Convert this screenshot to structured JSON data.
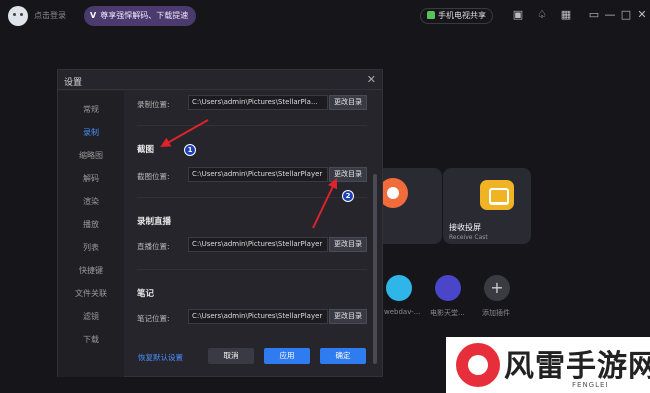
{
  "topbar": {
    "login": "点击登录",
    "vip": "尊享强悍解码、下载提速",
    "vip_mark": "V",
    "share": "手机电视共享",
    "icons": [
      "box-icon",
      "bell-icon",
      "grid-icon",
      "mini-icon",
      "minimize-icon",
      "maximize-icon",
      "close-icon"
    ]
  },
  "main": {
    "cast_title": "接收投屏",
    "cast_sub": "Receive Cast",
    "tools": [
      "webdav-...",
      "电影天堂...",
      "添加插件"
    ]
  },
  "dialog": {
    "title": "设置",
    "nav": [
      "常规",
      "录制",
      "缩略图",
      "解码",
      "渲染",
      "播放",
      "列表",
      "快捷键",
      "文件关联",
      "滤镜",
      "下载"
    ],
    "active_nav": "录制",
    "sections": {
      "record_path_label": "录制位置:",
      "record_path": "C:\\Users\\admin\\Pictures\\StellarPla...",
      "screenshot_title": "截图",
      "screenshot_path_label": "截图位置:",
      "screenshot_path": "C:\\Users\\admin\\Pictures\\StellarPlayer",
      "live_title": "录制直播",
      "live_path_label": "直播位置:",
      "live_path": "C:\\Users\\admin\\Pictures\\StellarPlayer",
      "notes_title": "笔记",
      "notes_path_label": "笔记位置:",
      "notes_path": "C:\\Users\\admin\\Pictures\\StellarPlayer",
      "change_dir": "更改目录"
    },
    "reset": "恢复默认设置",
    "cancel": "取消",
    "apply": "应用",
    "ok": "确定"
  },
  "annotations": {
    "one": "1",
    "two": "2"
  },
  "watermark": {
    "text": "风雷手游网",
    "sub": "FENGLEI"
  },
  "colors": {
    "accent": "#2f7bf0",
    "arrow": "#e0222c"
  }
}
